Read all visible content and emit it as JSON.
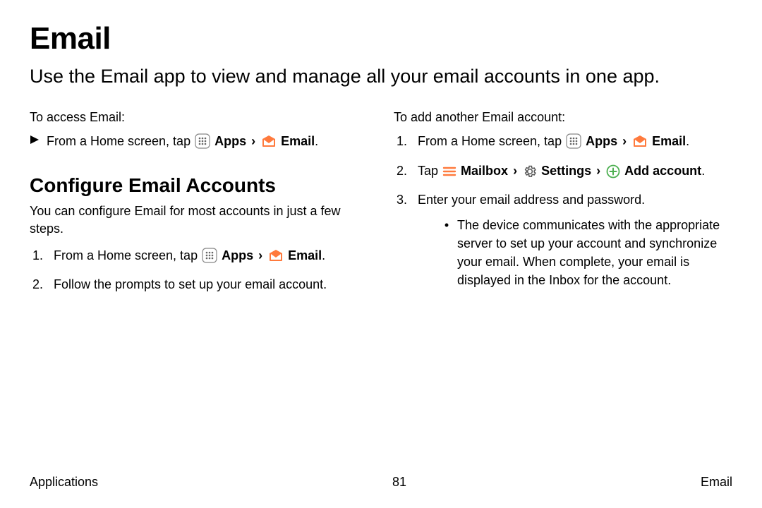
{
  "title": "Email",
  "subtitle": "Use the Email app to view and manage all your email accounts in one app.",
  "left": {
    "access_lead": "To access Email:",
    "access_item_prefix": "From a Home screen, tap ",
    "apps_label": "Apps",
    "email_label": "Email",
    "section_heading": "Configure Email Accounts",
    "section_intro": "You can configure Email for most accounts in just a few steps.",
    "step1_prefix": "From a Home screen, tap ",
    "step2": "Follow the prompts to set up your email account."
  },
  "right": {
    "lead": "To add another Email account:",
    "step1_prefix": "From a Home screen, tap ",
    "apps_label": "Apps",
    "email_label": "Email",
    "step2_prefix": "Tap ",
    "mailbox_label": "Mailbox",
    "settings_label": "Settings",
    "add_account_label": "Add account",
    "step3": "Enter your email address and password.",
    "sub_bullet": "The device communicates with the appropriate server to set up your account and synchronize your email. When complete, your email is displayed in the Inbox for the account."
  },
  "footer": {
    "left": "Applications",
    "center": "81",
    "right": "Email"
  },
  "glyphs": {
    "chevron": "›"
  }
}
